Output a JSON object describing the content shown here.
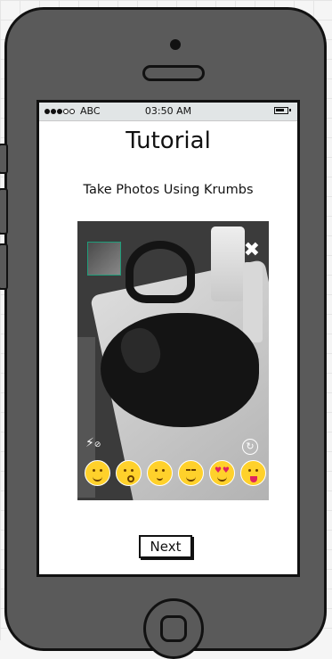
{
  "status_bar": {
    "carrier": "ABC",
    "time": "03:50 AM",
    "signal_icon": "signal-dots-icon",
    "battery_icon": "battery-icon"
  },
  "page": {
    "title": "Tutorial",
    "subtitle": "Take Photos Using Krumbs"
  },
  "camera_preview": {
    "close_icon": "close-x-icon",
    "flash_icon": "flash-off-icon",
    "flip_icon": "switch-camera-icon",
    "emojis": [
      "smiling-face",
      "kissing-face",
      "neutral-face",
      "relieved-face",
      "heart-eyes-face",
      "tongue-face"
    ],
    "thumbnail_border_color": "#1f9d7a"
  },
  "actions": {
    "next_label": "Next"
  }
}
